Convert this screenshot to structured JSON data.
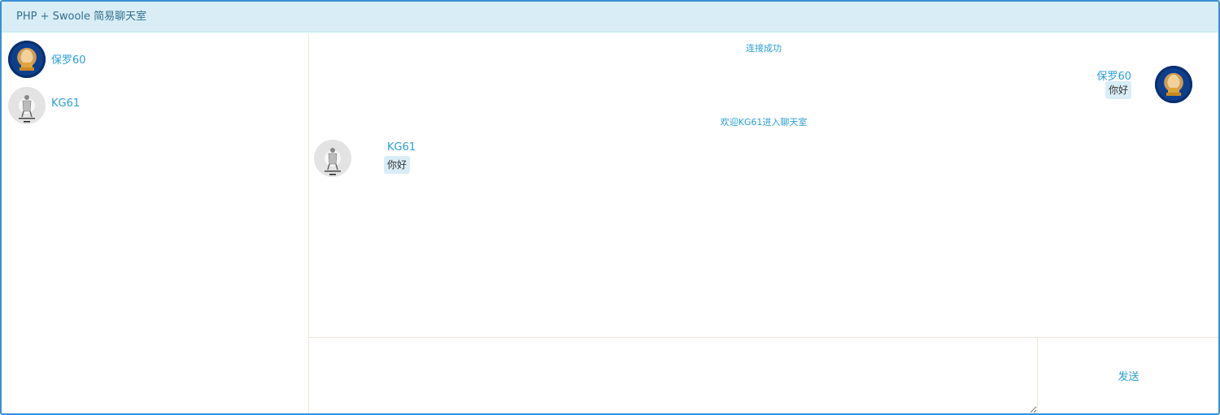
{
  "header": {
    "title": "PHP + Swoole 简易聊天室"
  },
  "sidebar": {
    "users": [
      {
        "name": "保罗60",
        "avatar": "paul-avatar"
      },
      {
        "name": "KG61",
        "avatar": "kg-avatar"
      }
    ]
  },
  "chat": {
    "system_connect": "连接成功",
    "msg1": {
      "name": "保罗60",
      "text": "你好"
    },
    "system_welcome": "欢迎KG61进入聊天室",
    "msg2": {
      "name": "KG61",
      "text": "你好"
    }
  },
  "composer": {
    "value": "",
    "send_label": "发送"
  },
  "colors": {
    "accent": "#2a9fd6",
    "header_bg": "#d9edf7",
    "border": "#3a8fd6"
  }
}
